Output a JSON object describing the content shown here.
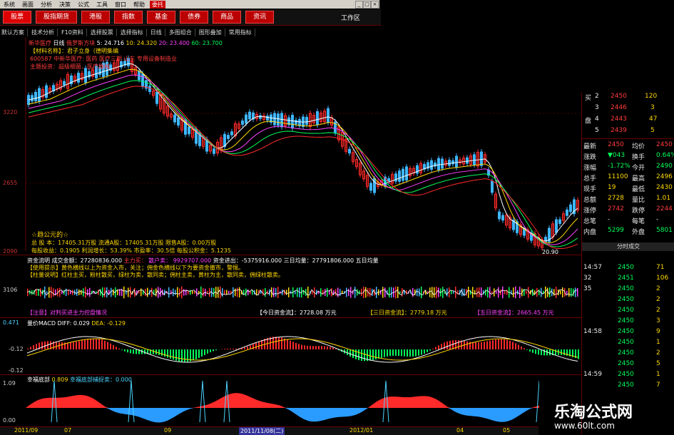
{
  "menu": {
    "items": [
      "系统",
      "画面",
      "分析",
      "决策",
      "公式",
      "工具",
      "窗口",
      "帮助"
    ],
    "active": "委托"
  },
  "tabs": [
    "股票",
    "股指期货",
    "港股",
    "指数",
    "基金",
    "债券",
    "商品",
    "资讯"
  ],
  "work_window": "工作区",
  "toolbar": [
    "默认方案",
    "技术分析",
    "F10资料",
    "选择股票",
    "选择指标",
    "日线",
    "多图组合",
    "图形叠加",
    "常用指标"
  ],
  "chart": {
    "stock_title": "新华医疗",
    "period": "日线",
    "chart_mode": "俄罗斯方块",
    "ma_values": [
      "5: 24.716",
      "10: 24.320",
      "20: 23.400",
      "60: 23.700"
    ],
    "notes": [
      "【材料名称】：君子立身（德明集编",
      "600587 中新华医疗: 医药 医疗三期 山东 专用设备制造业",
      "主题投资：超级细菌，医疗器械"
    ],
    "y_labels": [
      "3220",
      "2655",
      "2090"
    ],
    "low_label": "20.90",
    "watch_label": "☆趋公元的☆",
    "info_lines": [
      "总 股 本：17405.31万股  流通A股：17405.31万股  限售A股：0.00万股",
      "每股收益：0.1905  利润增长：53.39%  市盈率：30.5倍  每股公积金：5.1235"
    ]
  },
  "fund_flow": {
    "header_items": [
      "资金流明 成交金额：27280836.000",
      "主力买：",
      "散户卖：",
      "9929707.000",
      "资金进出：-5375916.000",
      "三日均量：27791806.000",
      "五日均量"
    ],
    "desc1": "【使用提示】黄色横线以上为资金入市，关注；佣金色横线以下为要资金撤市，警惕。",
    "desc2": "【柱量说明】红柱主买，粉柱散买，绿柱为卖，散同卖；佣柱主卖，黄柱为主，散同卖，佣绿柱散卖。",
    "y_label": "3106",
    "summary": [
      "【今日资金流】：2728.08 万元",
      "【三日资金流】：2779.18 万元",
      "【五日资金流】：2665.45 万元"
    ],
    "summary_left": "【注意】对判买进主力控盘情况"
  },
  "macd": {
    "title": "量价MACD",
    "values": [
      "DIFF: 0.029",
      "DEA: -0.129"
    ],
    "y_labels": [
      "0.471",
      "-0.12",
      "-0.12"
    ]
  },
  "bottom_indicator": {
    "title": "幸福底部",
    "sub": "幸福底部捕捉卖：0.000",
    "value_left": "0.809",
    "y_labels": [
      "1.09",
      "0.00"
    ]
  },
  "quote_panel": {
    "bids": [
      {
        "label": "买",
        "level": "2",
        "price": "2450",
        "vol": "120"
      },
      {
        "label": "",
        "level": "3",
        "price": "2446",
        "vol": "3"
      },
      {
        "label": "盘",
        "level": "4",
        "price": "2443",
        "vol": "47"
      },
      {
        "label": "",
        "level": "5",
        "price": "2439",
        "vol": "5"
      }
    ],
    "stats": [
      {
        "k": "最新",
        "v": "2450",
        "k2": "均价",
        "v2": "2450"
      },
      {
        "k": "涨跌",
        "v": "▼043",
        "k2": "换手",
        "v2": "0.64%"
      },
      {
        "k": "涨幅",
        "v": "-1.72%",
        "k2": "今开",
        "v2": "2490"
      },
      {
        "k": "总手",
        "v": "11100",
        "k2": "最高",
        "v2": "2496"
      },
      {
        "k": "现手",
        "v": "19",
        "k2": "最低",
        "v2": "2430"
      },
      {
        "k": "总额",
        "v": "2728",
        "k2": "量比",
        "v2": "1.01"
      },
      {
        "k": "涨停",
        "v": "2742",
        "k2": "跌停",
        "v2": "2244"
      },
      {
        "k": "总笔",
        "v": "-",
        "k2": "每笔",
        "v2": "-"
      },
      {
        "k": "内盘",
        "v": "5299",
        "k2": "外盘",
        "v2": "5801"
      }
    ],
    "ticks_header": "分时成交",
    "ticks": [
      {
        "t": "14:57",
        "p": "2450",
        "v": "71"
      },
      {
        "t": "32",
        "p": "2451",
        "v": "106"
      },
      {
        "t": "35",
        "p": "2450",
        "v": "2"
      },
      {
        "t": "",
        "p": "2450",
        "v": "2"
      },
      {
        "t": "",
        "p": "2450",
        "v": "2"
      },
      {
        "t": "",
        "p": "2450",
        "v": "3"
      },
      {
        "t": "14:58",
        "p": "2450",
        "v": "9"
      },
      {
        "t": "",
        "p": "2450",
        "v": "1"
      },
      {
        "t": "",
        "p": "2450",
        "v": "2"
      },
      {
        "t": "",
        "p": "2450",
        "v": "5"
      },
      {
        "t": "14:59",
        "p": "2450",
        "v": "1"
      },
      {
        "t": "",
        "p": "2450",
        "v": "7"
      }
    ]
  },
  "date_bar": [
    "2011/09",
    "07",
    "09",
    "2011/11/08(二)",
    "2012/01",
    "04",
    "05"
  ],
  "watermark": {
    "title": "乐淘公式网",
    "url": "www.60lt.com"
  }
}
